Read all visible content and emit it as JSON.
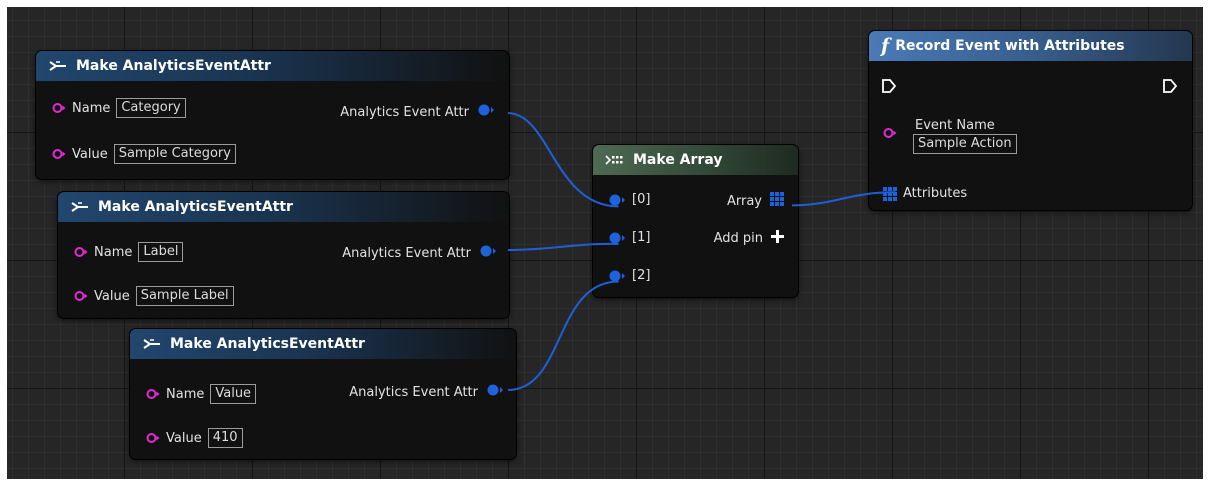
{
  "nodes": {
    "make_attr_1": {
      "title": "Make AnalyticsEventAttr",
      "name_label": "Name",
      "name_value": "Category",
      "value_label": "Value",
      "value_value": "Sample Category",
      "output_label": "Analytics Event Attr"
    },
    "make_attr_2": {
      "title": "Make AnalyticsEventAttr",
      "name_label": "Name",
      "name_value": "Label",
      "value_label": "Value",
      "value_value": "Sample Label",
      "output_label": "Analytics Event Attr"
    },
    "make_attr_3": {
      "title": "Make AnalyticsEventAttr",
      "name_label": "Name",
      "name_value": "Value",
      "value_label": "Value",
      "value_value": "410",
      "output_label": "Analytics Event Attr"
    },
    "make_array": {
      "title": "Make Array",
      "pins": [
        "[0]",
        "[1]",
        "[2]"
      ],
      "output_label": "Array",
      "add_pin_label": "Add pin"
    },
    "record_event": {
      "title_glyph": "f",
      "title": "Record Event with Attributes",
      "event_name_label": "Event Name",
      "event_name_value": "Sample Action",
      "attributes_label": "Attributes"
    }
  },
  "colors": {
    "struct_pin": "#1e63dc",
    "string_pin": "#e02bd0",
    "exec_pin": "#ffffff",
    "wire": "#1f5fd6"
  },
  "icons": {
    "make_struct": "make-struct-icon",
    "make_array": "make-array-icon",
    "function": "function-icon",
    "add": "plus-icon"
  }
}
